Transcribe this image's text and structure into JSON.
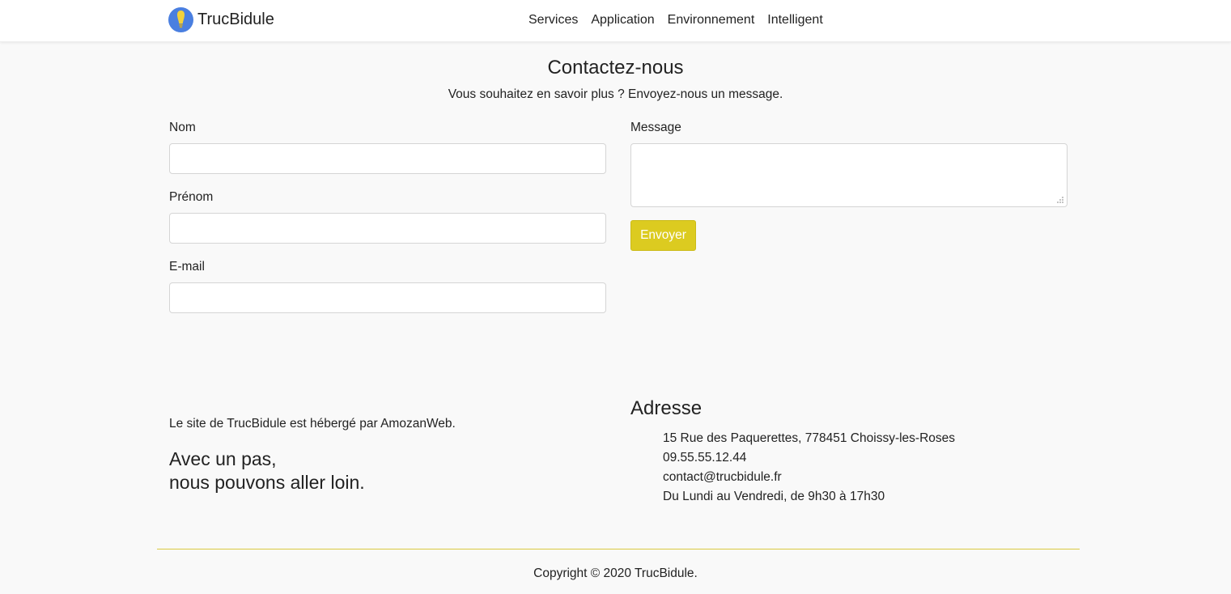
{
  "colors": {
    "accent": "#dccb20",
    "background": "#f9f9f9",
    "logo_circle": "#4a7fe0",
    "logo_bulb": "#f2d13a"
  },
  "header": {
    "logo_icon": "lightbulb-icon",
    "brand": "TrucBidule",
    "nav": [
      "Services",
      "Application",
      "Environnement",
      "Intelligent"
    ]
  },
  "contact": {
    "title": "Contactez-nous",
    "subtitle": "Vous souhaitez en savoir plus ? Envoyez-nous un message.",
    "fields": {
      "nom": {
        "label": "Nom",
        "value": "",
        "placeholder": ""
      },
      "prenom": {
        "label": "Prénom",
        "value": "",
        "placeholder": ""
      },
      "email": {
        "label": "E-mail",
        "value": "",
        "placeholder": ""
      },
      "message": {
        "label": "Message",
        "value": "",
        "placeholder": ""
      }
    },
    "submit_label": "Envoyer"
  },
  "info": {
    "host_text": "Le site de TrucBidule est hébergé par AmozanWeb.",
    "slogan": [
      "Avec un pas,",
      "nous pouvons aller loin."
    ],
    "address_title": "Adresse",
    "address_lines": [
      "15 Rue des Paquerettes, 778451 Choissy-les-Roses",
      "09.55.55.12.44",
      "contact@trucbidule.fr",
      "Du Lundi au Vendredi, de 9h30 à 17h30"
    ]
  },
  "footer": {
    "copyright": "Copyright © 2020 TrucBidule."
  }
}
